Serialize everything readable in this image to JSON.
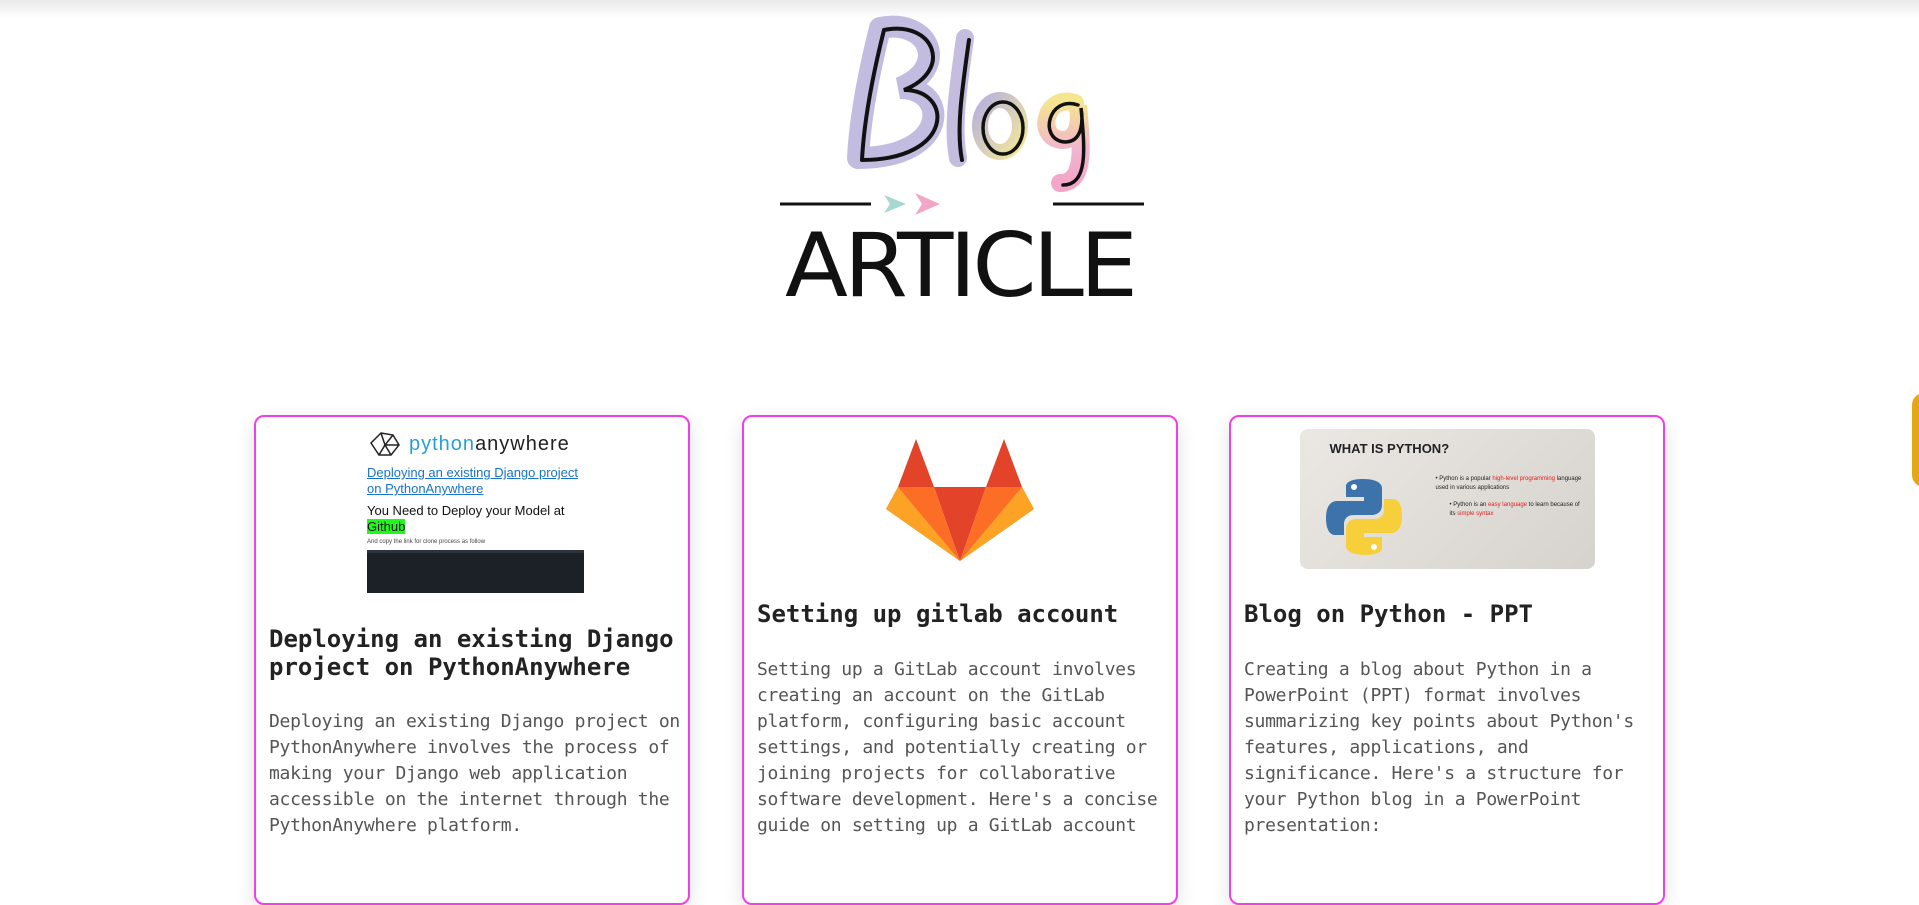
{
  "header": {
    "logo_text": "Blog",
    "section_title": "ARTICLE"
  },
  "colors": {
    "card_border": "#ef3fe8",
    "accent_teal": "#a6d8d0",
    "accent_pink": "#f2a7c9",
    "side_tab": "#e4a817"
  },
  "articles": [
    {
      "title": "Deploying an existing Django project on PythonAnywhere",
      "text": "Deploying an existing Django project on PythonAnywhere involves the process of making your Django web application accessible on the internet through the PythonAnywhere platform.",
      "thumbnail": {
        "brand_python": "python",
        "brand_anywhere": "anywhere",
        "link": "Deploying an existing Django project on PythonAnywhere",
        "need_text": "You Need to Deploy your Model at",
        "highlight": "Github",
        "small_text": "And copy the link for clone process as follow"
      }
    },
    {
      "title": "Setting up gitlab account",
      "text": "Setting up a GitLab account involves creating an account on the GitLab platform, configuring basic account settings, and potentially creating or joining projects for collaborative software development. Here's a concise guide on setting up a GitLab account",
      "thumbnail": {
        "icon": "gitlab-logo"
      }
    },
    {
      "title": "Blog on Python - PPT",
      "text": "Creating a blog about Python in a PowerPoint (PPT) format involves summarizing key points about Python's features, applications, and significance. Here's a structure for your Python blog in a PowerPoint presentation:",
      "thumbnail": {
        "slide_title": "WHAT IS PYTHON?",
        "b1_pre": "Python is a popular ",
        "b1_red": "high-level programming",
        "b1_post": " language used in various applications",
        "b2_pre": "Python is an ",
        "b2_red": "easy language",
        "b2_mid": " to learn because of its ",
        "b2_red2": "simple syntax"
      }
    }
  ]
}
